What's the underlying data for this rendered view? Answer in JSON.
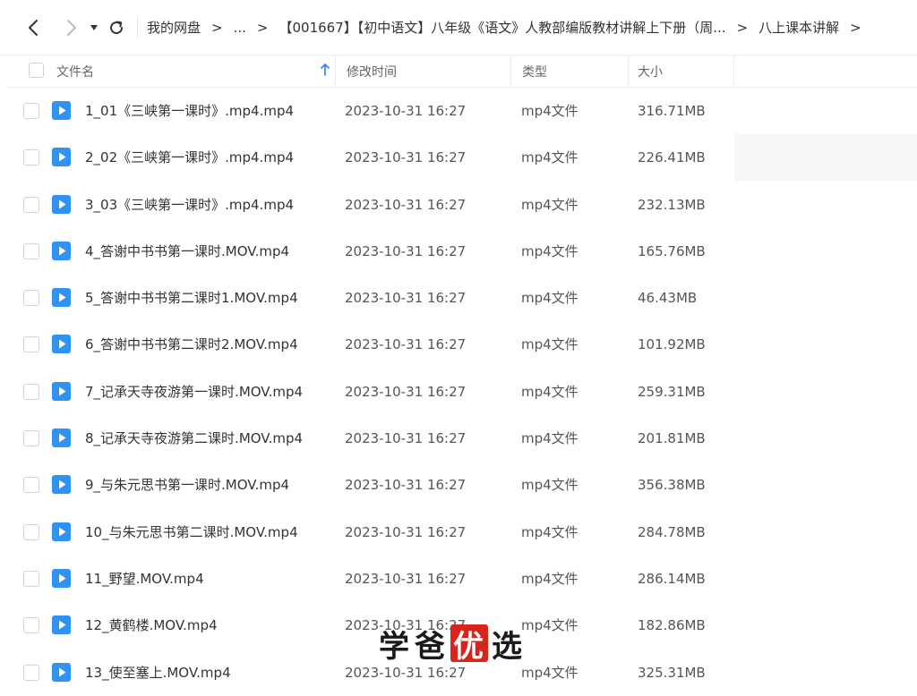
{
  "toolbar": {
    "icons": {
      "back": "chevron-left-icon",
      "forward": "chevron-right-icon",
      "dropdown": "caret-down-icon",
      "refresh": "refresh-icon"
    },
    "breadcrumb": {
      "root": "我的网盘",
      "separator": ">",
      "ellipsis": "...",
      "folder": "【001667】【初中语文】八年级《语文》人教部编版教材讲解上下册（周...",
      "current": "八上课本讲解"
    }
  },
  "table": {
    "columns": {
      "name": "文件名",
      "modified": "修改时间",
      "type": "类型",
      "size": "大小"
    },
    "sort_icon": "arrow-up-icon",
    "accent_color": "#2f7bf5",
    "file_icon": "video-file-icon",
    "rows": [
      {
        "name": "1_01《三峡第一课时》.mp4.mp4",
        "modified": "2023-10-31 16:27",
        "type": "mp4文件",
        "size": "316.71MB"
      },
      {
        "name": "2_02《三峡第一课时》.mp4.mp4",
        "modified": "2023-10-31 16:27",
        "type": "mp4文件",
        "size": "226.41MB"
      },
      {
        "name": "3_03《三峡第一课时》.mp4.mp4",
        "modified": "2023-10-31 16:27",
        "type": "mp4文件",
        "size": "232.13MB"
      },
      {
        "name": "4_答谢中书书第一课时.MOV.mp4",
        "modified": "2023-10-31 16:27",
        "type": "mp4文件",
        "size": "165.76MB"
      },
      {
        "name": "5_答谢中书书第二课时1.MOV.mp4",
        "modified": "2023-10-31 16:27",
        "type": "mp4文件",
        "size": "46.43MB"
      },
      {
        "name": "6_答谢中书书第二课时2.MOV.mp4",
        "modified": "2023-10-31 16:27",
        "type": "mp4文件",
        "size": "101.92MB"
      },
      {
        "name": "7_记承天寺夜游第一课时.MOV.mp4",
        "modified": "2023-10-31 16:27",
        "type": "mp4文件",
        "size": "259.31MB"
      },
      {
        "name": "8_记承天寺夜游第二课时.MOV.mp4",
        "modified": "2023-10-31 16:27",
        "type": "mp4文件",
        "size": "201.81MB"
      },
      {
        "name": "9_与朱元思书第一课时.MOV.mp4",
        "modified": "2023-10-31 16:27",
        "type": "mp4文件",
        "size": "356.38MB"
      },
      {
        "name": "10_与朱元思书第二课时.MOV.mp4",
        "modified": "2023-10-31 16:27",
        "type": "mp4文件",
        "size": "284.78MB"
      },
      {
        "name": "11_野望.MOV.mp4",
        "modified": "2023-10-31 16:27",
        "type": "mp4文件",
        "size": "286.14MB"
      },
      {
        "name": "12_黄鹤楼.MOV.mp4",
        "modified": "2023-10-31 16:27",
        "type": "mp4文件",
        "size": "182.86MB"
      },
      {
        "name": "13_使至塞上.MOV.mp4",
        "modified": "2023-10-31 16:27",
        "type": "mp4文件",
        "size": "325.31MB"
      }
    ]
  },
  "watermark": {
    "char1": "学",
    "char2": "爸",
    "char3": "优",
    "char4": "选",
    "highlight_color": "#d9241c"
  }
}
